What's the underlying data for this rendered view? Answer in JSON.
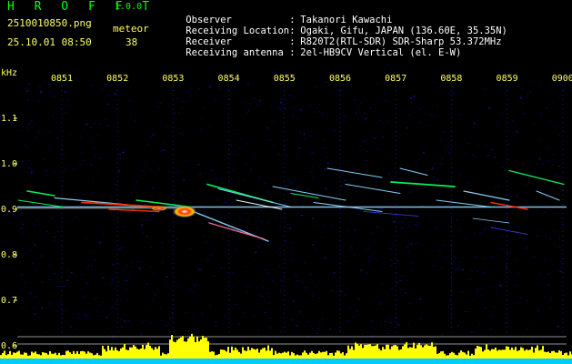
{
  "header": {
    "app_title": "H R O F F T",
    "app_version": "1.0.0",
    "file_name": "2510010850.png",
    "meteor_label": "meteor",
    "date_time": "25.10.01 08:50",
    "meteor_count": "38"
  },
  "info": [
    {
      "key": "Observer",
      "sep": ":",
      "value": "Takanori Kawachi"
    },
    {
      "key": "Receiving Location",
      "sep": ":",
      "value": "Ogaki, Gifu, JAPAN (136.60E, 35.35N)"
    },
    {
      "key": "Receiver",
      "sep": ":",
      "value": "R820T2(RTL-SDR) SDR-Sharp 53.372MHz"
    },
    {
      "key": "Receiving antenna",
      "sep": ":",
      "value": "2el-HB9CV Vertical (el. E-W)"
    }
  ],
  "plot": {
    "y_unit": "kHz",
    "time_ticks": [
      "0851",
      "0852",
      "0853",
      "0854",
      "0855",
      "0856",
      "0857",
      "0858",
      "0859",
      "0900"
    ],
    "freq_ticks": [
      "1.1",
      "1.0",
      "0.9",
      "0.8",
      "0.7",
      "0.6"
    ],
    "colors": {
      "background": "#000000",
      "noise": "#0a0a8c",
      "carrier": "#8fd8ff",
      "echo_strong": "#ff3300",
      "echo_mid": "#00ff66",
      "axis_text": "#ffff66",
      "level_bar": "#ffff00",
      "level_base": "#00ccff"
    }
  }
}
